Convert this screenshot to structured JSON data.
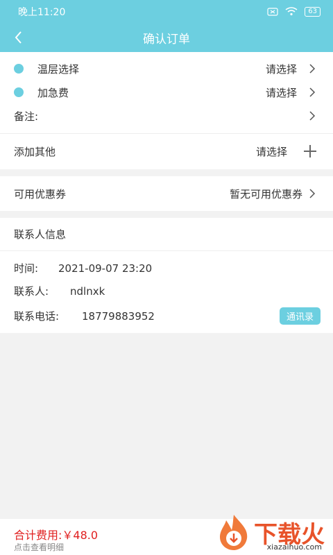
{
  "status": {
    "time": "晚上11:20",
    "battery": "63"
  },
  "nav": {
    "title": "确认订单"
  },
  "options": {
    "temp_label": "温层选择",
    "temp_value": "请选择",
    "urgent_label": "加急费",
    "urgent_value": "请选择",
    "remark_label": "备注:"
  },
  "other": {
    "label": "添加其他",
    "value": "请选择"
  },
  "coupon": {
    "label": "可用优惠券",
    "value": "暂无可用优惠券"
  },
  "contact": {
    "section_title": "联系人信息",
    "time_label": "时间:",
    "time_value": "2021-09-07 23:20",
    "person_label": "联系人:",
    "person_value": "ndlnxk",
    "phone_label": "联系电话:",
    "phone_value": "18779883952",
    "contacts_button": "通讯录"
  },
  "footer": {
    "total": "合计费用:￥48.0",
    "detail": "点击查看明细"
  },
  "watermark": {
    "text": "下载火",
    "sub": "xiazaihuo.com"
  },
  "colors": {
    "accent": "#6ccfe0",
    "price": "#e02020"
  }
}
